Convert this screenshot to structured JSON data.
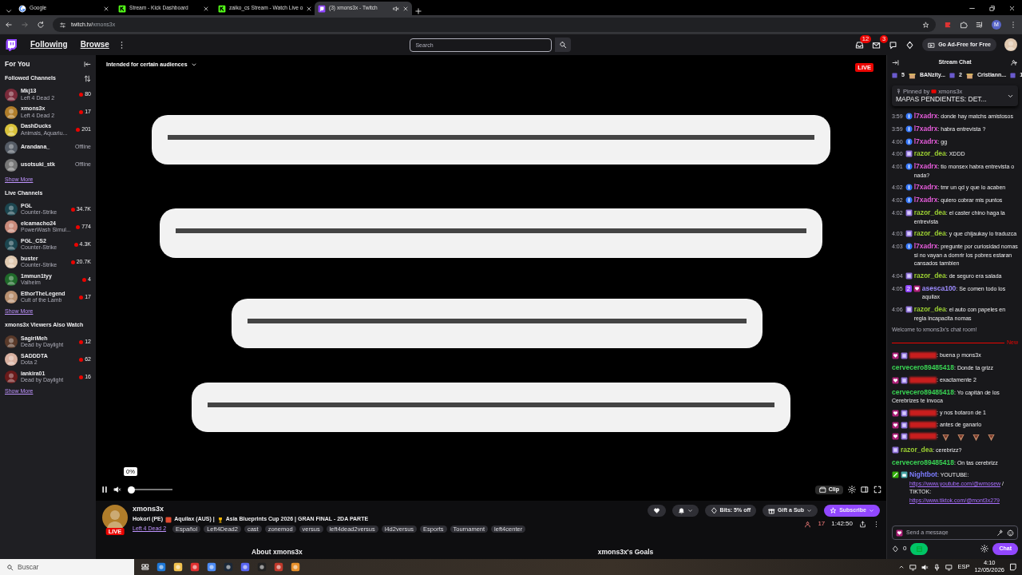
{
  "browser": {
    "tabs": [
      {
        "title": "Google",
        "kind": "google",
        "selected": false,
        "audio": false
      },
      {
        "title": "Stream - Kick Dashboard",
        "kind": "kick",
        "selected": false,
        "audio": false
      },
      {
        "title": "zaiko_cs Stream - Watch Live o",
        "kind": "kick",
        "selected": false,
        "audio": false
      },
      {
        "title": "(3) xmons3x - Twitch",
        "kind": "twitch",
        "selected": true,
        "audio": true
      }
    ],
    "url_host": "twitch.tv/",
    "url_path": "xmons3x",
    "profile_initial": "M"
  },
  "nav": {
    "links": [
      "Following",
      "Browse"
    ],
    "search": {
      "placeholder": "Search"
    },
    "badges": [
      "12",
      "3"
    ],
    "ad_free": "Go Ad-Free for Free"
  },
  "sidebar": {
    "title": "For You",
    "sections": [
      {
        "heading": "Followed Channels",
        "show_more": "Show More",
        "channels": [
          {
            "name": "Mkj13",
            "game": "Left 4 Dead 2",
            "count": "80",
            "live": true
          },
          {
            "name": "xmons3x",
            "game": "Left 4 Dead 2",
            "count": "17",
            "live": true
          },
          {
            "name": "DashDucks",
            "game": "Animals, Aquariu...",
            "count": "201",
            "live": true
          },
          {
            "name": "Arandana_",
            "count": "Offline",
            "live": false
          },
          {
            "name": "usotsuki_stk",
            "count": "Offline",
            "live": false
          }
        ]
      },
      {
        "heading": "Live Channels",
        "show_more": "Show More",
        "channels": [
          {
            "name": "PGL",
            "game": "Counter-Strike",
            "count": "34.7K",
            "live": true
          },
          {
            "name": "elcamacho24",
            "game": "PowerWash Simul...",
            "count": "774",
            "live": true
          },
          {
            "name": "PGL_CS2",
            "game": "Counter-Strike",
            "count": "4.3K",
            "live": true
          },
          {
            "name": "buster",
            "game": "Counter-Strike",
            "count": "20.7K",
            "live": true
          },
          {
            "name": "1mmun1tyy",
            "game": "Valheim",
            "count": "4",
            "live": true
          },
          {
            "name": "EthorTheLegend",
            "game": "Cult of the Lamb",
            "count": "17",
            "live": true
          }
        ]
      },
      {
        "heading": "xmons3x Viewers Also Watch",
        "show_more": "Show More",
        "channels": [
          {
            "name": "SagiriMeh",
            "game": "Dead by Daylight",
            "count": "12",
            "live": true
          },
          {
            "name": "SADDDTA",
            "game": "Dota 2",
            "count": "62",
            "live": true
          },
          {
            "name": "iankira01",
            "game": "Dead by Daylight",
            "count": "16",
            "live": true
          }
        ]
      }
    ]
  },
  "video": {
    "audience": "Intended for certain audiences",
    "live": "LIVE",
    "volume": {
      "level": 0,
      "reading": "0%"
    },
    "clip": "Clip"
  },
  "stream": {
    "channel": "xmons3x",
    "live": "LIVE",
    "title": [
      "Hokori (PE)",
      "Aquilax (AUS) |",
      "Asia Blueprints Cup 2026 | GRAN FINAL - 2DA PARTE"
    ],
    "game": "Left 4 Dead 2",
    "tags": [
      "Español",
      "Left4Dead2",
      "cast",
      "zonemod",
      "versus",
      "left4dead2versus",
      "l4d2versus",
      "Esports",
      "Tournament",
      "left4center"
    ],
    "bits": "Bits: 5% off",
    "gift": "Gift a Sub",
    "subscribe": "Subscribe",
    "viewers": "17",
    "uptime": "1:42:50",
    "about": "About xmons3x",
    "goals": "xmons3x's Goals"
  },
  "chat": {
    "title": "Stream Chat",
    "leaderboard": [
      {
        "count": "5"
      },
      {
        "name": "BANzity...",
        "count": "2"
      },
      {
        "name": "Cristiann...",
        "count": "1"
      }
    ],
    "pinned": {
      "label": "Pinned by",
      "by": "xmons3x",
      "text": "MAPAS PENDIENTES: DET..."
    },
    "messages": [
      {
        "kind": "message",
        "time": "3:59",
        "badges": [
          {
            "kind": "info"
          }
        ],
        "user": "l7xadrx",
        "color": "#e35bd8",
        "parts": [
          {
            "kind": "text",
            "text": ": donde hay matchs amistosos"
          }
        ]
      },
      {
        "kind": "message",
        "time": "3:59",
        "badges": [
          {
            "kind": "info"
          }
        ],
        "user": "l7xadrx",
        "color": "#e35bd8",
        "parts": [
          {
            "kind": "text",
            "text": ": habra entrevista ?"
          }
        ]
      },
      {
        "kind": "message",
        "time": "4:00",
        "badges": [
          {
            "kind": "info"
          }
        ],
        "user": "l7xadrx",
        "color": "#e35bd8",
        "parts": [
          {
            "kind": "text",
            "text": ": gg"
          }
        ]
      },
      {
        "kind": "message",
        "time": "4:00",
        "badges": [
          {
            "kind": "sub"
          }
        ],
        "user": "razor_dea",
        "color": "#9acd32",
        "parts": [
          {
            "kind": "text",
            "text": ": XDDD"
          }
        ]
      },
      {
        "kind": "message",
        "time": "4:01",
        "badges": [
          {
            "kind": "info"
          }
        ],
        "user": "l7xadrx",
        "color": "#e35bd8",
        "parts": [
          {
            "kind": "text",
            "text": ": tio monsex habra entrevista o nada?"
          }
        ]
      },
      {
        "kind": "message",
        "time": "4:02",
        "badges": [
          {
            "kind": "info"
          }
        ],
        "user": "l7xadrx",
        "color": "#e35bd8",
        "parts": [
          {
            "kind": "text",
            "text": ": tmr un qd y que lo acaben"
          }
        ]
      },
      {
        "kind": "message",
        "time": "4:02",
        "badges": [
          {
            "kind": "info"
          }
        ],
        "user": "l7xadrx",
        "color": "#e35bd8",
        "parts": [
          {
            "kind": "text",
            "text": ": quiero cobrar mis puntos"
          }
        ]
      },
      {
        "kind": "message",
        "time": "4:02",
        "badges": [
          {
            "kind": "sub"
          }
        ],
        "user": "razor_dea",
        "color": "#9acd32",
        "parts": [
          {
            "kind": "text",
            "text": ": el caster chino haga la entrevista"
          }
        ]
      },
      {
        "kind": "message",
        "time": "4:03",
        "badges": [
          {
            "kind": "sub"
          }
        ],
        "user": "razor_dea",
        "color": "#9acd32",
        "parts": [
          {
            "kind": "text",
            "text": ": y que chijaukay lo traduzca"
          }
        ]
      },
      {
        "kind": "message",
        "time": "4:03",
        "badges": [
          {
            "kind": "info"
          }
        ],
        "user": "l7xadrx",
        "color": "#e35bd8",
        "parts": [
          {
            "kind": "text",
            "text": ": pregunte por curiosidad nomas si no vayan a domrir los pobres estaran cansados tambien"
          }
        ]
      },
      {
        "kind": "message",
        "time": "4:04",
        "badges": [
          {
            "kind": "sub"
          }
        ],
        "user": "razor_dea",
        "color": "#9acd32",
        "parts": [
          {
            "kind": "text",
            "text": ": de seguro era salada"
          }
        ]
      },
      {
        "kind": "message",
        "time": "4:05",
        "badges": [
          {
            "kind": "level",
            "text": "2"
          },
          {
            "kind": "heart"
          }
        ],
        "user": "asesca100",
        "color": "#9d8cff",
        "parts": [
          {
            "kind": "text",
            "text": ": Se comen todo los aquilax"
          }
        ]
      },
      {
        "kind": "message",
        "time": "4:06",
        "badges": [
          {
            "kind": "sub"
          }
        ],
        "user": "razor_dea",
        "color": "#9acd32",
        "parts": [
          {
            "kind": "text",
            "text": ": el auto con papeles en regla incapacita nomas"
          }
        ]
      },
      {
        "kind": "notice",
        "text": "Welcome to xmons3x's chat room!"
      },
      {
        "kind": "divider",
        "text": "New"
      },
      {
        "kind": "message",
        "badges": [
          {
            "kind": "heart"
          },
          {
            "kind": "sub"
          }
        ],
        "redacted": true,
        "color": "#c81e1e",
        "parts": [
          {
            "kind": "text",
            "text": ": buena p mons3x"
          }
        ]
      },
      {
        "kind": "message",
        "user": "cervecero89485418",
        "color": "#39d353",
        "parts": [
          {
            "kind": "text",
            "text": ": Donde ta grizz"
          }
        ]
      },
      {
        "kind": "message",
        "badges": [
          {
            "kind": "heart"
          },
          {
            "kind": "sub"
          }
        ],
        "redacted": true,
        "color": "#c81e1e",
        "parts": [
          {
            "kind": "text",
            "text": ": exactamente 2"
          }
        ]
      },
      {
        "kind": "message",
        "user": "cervecero89485418",
        "color": "#39d353",
        "parts": [
          {
            "kind": "text",
            "text": ": Yo capitán de los Cerebrizes te invoca"
          }
        ]
      },
      {
        "kind": "message",
        "badges": [
          {
            "kind": "heart"
          },
          {
            "kind": "sub"
          }
        ],
        "redacted": true,
        "color": "#c81e1e",
        "parts": [
          {
            "kind": "text",
            "text": ": y nos botaron de 1"
          }
        ]
      },
      {
        "kind": "message",
        "badges": [
          {
            "kind": "heart"
          },
          {
            "kind": "sub"
          }
        ],
        "redacted": true,
        "color": "#c81e1e",
        "parts": [
          {
            "kind": "text",
            "text": ": antes de ganarlo"
          }
        ]
      },
      {
        "kind": "message",
        "badges": [
          {
            "kind": "heart"
          },
          {
            "kind": "sub"
          }
        ],
        "redacted": true,
        "color": "#c81e1e",
        "parts": [
          {
            "kind": "text",
            "text": ":"
          },
          {
            "kind": "emote"
          },
          {
            "kind": "emote"
          },
          {
            "kind": "emote"
          },
          {
            "kind": "emote"
          }
        ]
      },
      {
        "kind": "message",
        "badges": [
          {
            "kind": "sub"
          }
        ],
        "user": "razor_dea",
        "color": "#9acd32",
        "parts": [
          {
            "kind": "text",
            "text": ": cerebrizz?"
          }
        ]
      },
      {
        "kind": "message",
        "user": "cervecero89485418",
        "color": "#39d353",
        "parts": [
          {
            "kind": "text",
            "text": ": On tas cerebrizz"
          }
        ]
      },
      {
        "kind": "message",
        "badges": [
          {
            "kind": "mod"
          },
          {
            "kind": "bot"
          }
        ],
        "user": "Nightbot",
        "color": "#7c7cff",
        "parts": [
          {
            "kind": "text",
            "text": ": YOUTUBE:"
          },
          {
            "kind": "link",
            "text": "https://www.youtube.com/@wmosew"
          },
          {
            "kind": "text",
            "text": "/ TIKTOK:"
          },
          {
            "kind": "link",
            "text": "https://www.tiktok.com/@mont3x279"
          }
        ]
      }
    ],
    "input": {
      "placeholder": "Send a message"
    },
    "points": "0",
    "send": "Chat"
  },
  "taskbar": {
    "search": {
      "placeholder": "Buscar"
    },
    "language": "ESP",
    "time": "4:10",
    "date": "12/05/2026"
  }
}
